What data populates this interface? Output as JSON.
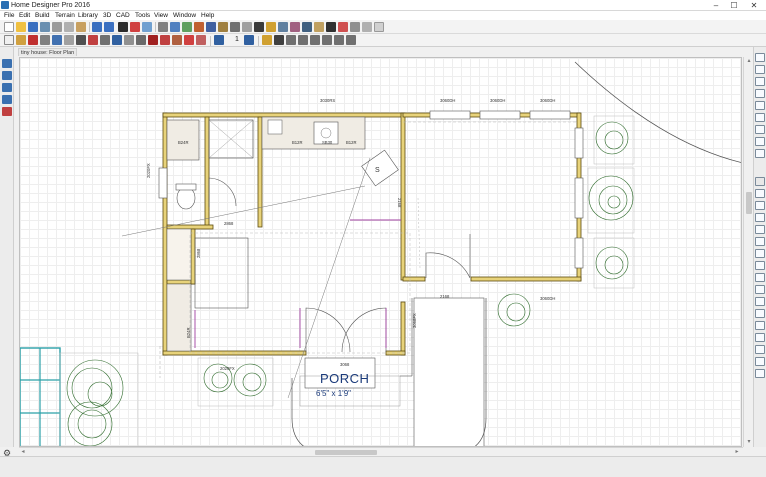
{
  "window": {
    "title": "Home Designer Pro 2016",
    "min_glyph": "–",
    "max_glyph": "☐",
    "close_glyph": "✕"
  },
  "menu": [
    "File",
    "Edit",
    "Build",
    "Terrain",
    "Library",
    "3D",
    "CAD",
    "Tools",
    "View",
    "Window",
    "Help"
  ],
  "document_tab": "tiny house: Floor Plan",
  "plan": {
    "porch_label": "PORCH",
    "porch_size": "6'5\" x 1'9\"",
    "dims": {
      "top_left_window": "3030RS",
      "top_right_1": "3060DH",
      "top_right_2": "3060DH",
      "top_right_3": "3060DH",
      "bath_left": "2020FX",
      "cab_1": "B24R",
      "cab_2": "B12R",
      "sink": "SB30",
      "cab_3": "B12R",
      "door_bath": "2868",
      "door_closet": "2868",
      "door_right": "2168",
      "porch_door": "3068",
      "porch_window": "3060",
      "right_door": "2168",
      "bottom_window": "2020FX",
      "bottom_right_dim": "3060DH",
      "porch_right": "3068FX",
      "pantry": "B24R",
      "fridge": "R",
      "range": "S"
    }
  },
  "status": {
    "gear_glyph": "⚙"
  },
  "colors": {
    "wall_fill": "#e8d37a",
    "wall_line": "#5a4a10",
    "door_line": "#a040a0",
    "grid": "#eeeeee"
  }
}
